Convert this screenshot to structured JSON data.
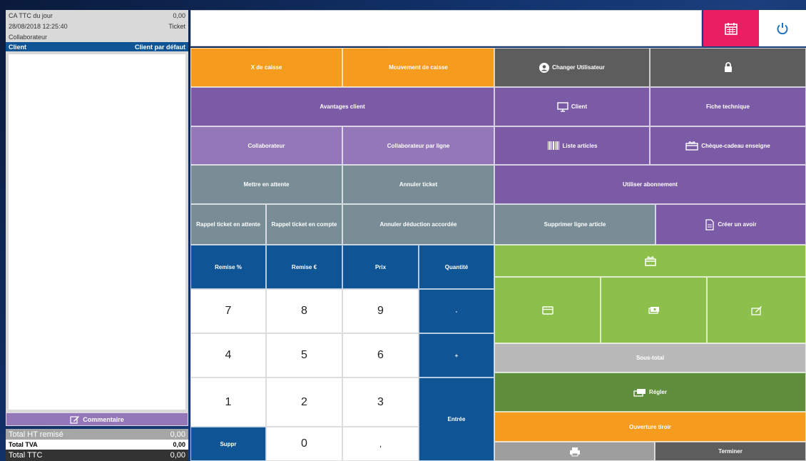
{
  "colors": {
    "orange": "#f59c1f",
    "dark_gray": "#5d5d5d",
    "purple": "#7b5ba6",
    "light_purple": "#9377b8",
    "slate": "#788d96",
    "blue": "#0f5596",
    "green": "#8cc04b",
    "dark_green": "#5f8e3c",
    "light_gray": "#b9b9b9",
    "pink": "#e91e63"
  },
  "left": {
    "ca_label": "CA TTC du jour",
    "ca_value": "0,00",
    "datetime": "28/08/2018  12:25:40",
    "ticket_label": "Ticket",
    "collab_label": "Collaborateur",
    "client_label": "Client",
    "client_value": "Client par défaut",
    "comment_label": "Commentaire",
    "total_ht_label": "Total HT remisé",
    "total_ht_value": "0,00",
    "total_tva_label": "Total TVA",
    "total_tva_value": "0,00",
    "total_ttc_label": "Total TTC",
    "total_ttc_value": "0,00"
  },
  "buttons": {
    "x_caisse": "X de caisse",
    "mouvement": "Mouvement de caisse",
    "changer_user": "Changer Utilisateur",
    "avantages": "Avantages client",
    "client": "Client",
    "fiche": "Fiche technique",
    "collab": "Collaborateur",
    "collab_ligne": "Collaborateur par ligne",
    "liste": "Liste articles",
    "cheque": "Chèque-cadeau enseigne",
    "attente": "Mettre en attente",
    "annuler_ticket": "Annuler ticket",
    "abonnement": "Utiliser abonnement",
    "rappel_attente": "Rappel ticket en attente",
    "rappel_compte": "Rappel ticket en compte",
    "annuler_deduction": "Annuler déduction accordée",
    "supprimer_ligne": "Supprimer ligne article",
    "avoir": "Créer un avoir",
    "remise_pct": "Remise %",
    "remise_eur": "Remise €",
    "prix": "Prix",
    "quantite": "Quantité",
    "minus": "-",
    "plus": "+",
    "entree": "Entrée",
    "suppr": "Suppr",
    "sous_total": "Sous-total",
    "regler": "Régler",
    "tiroir": "Ouverture tiroir",
    "terminer": "Terminer"
  },
  "keypad": {
    "k7": "7",
    "k8": "8",
    "k9": "9",
    "k4": "4",
    "k5": "5",
    "k6": "6",
    "k1": "1",
    "k2": "2",
    "k3": "3",
    "k0": "0",
    "comma": ","
  }
}
